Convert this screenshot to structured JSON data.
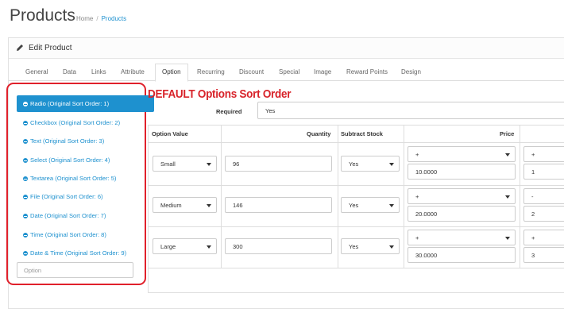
{
  "header": {
    "title": "Products",
    "breadcrumb": [
      "Home",
      "Products"
    ]
  },
  "panel": {
    "title": "Edit Product"
  },
  "tabs": [
    "General",
    "Data",
    "Links",
    "Attribute",
    "Option",
    "Recurring",
    "Discount",
    "Special",
    "Image",
    "Reward Points",
    "Design"
  ],
  "active_tab": "Option",
  "options": [
    "Radio (Original Sort Order: 1)",
    "Checkbox (Original Sort Order: 2)",
    "Text (Original Sort Order: 3)",
    "Select (Original Sort Order: 4)",
    "Textarea (Original Sort Order: 5)",
    "File (Original Sort Order: 6)",
    "Date (Original Sort Order: 7)",
    "Time (Original Sort Order: 8)",
    "Date & Time (Original Sort Order: 9)"
  ],
  "option_input": {
    "placeholder": "Option"
  },
  "annotation": "DEFAULT Options Sort Order",
  "required": {
    "label": "Required",
    "value": "Yes"
  },
  "table": {
    "headers": [
      "Option Value",
      "Quantity",
      "Subtract Stock",
      "Price"
    ],
    "rows": [
      {
        "value": "Small",
        "quantity": "96",
        "subtract": "Yes",
        "price_prefix": "+",
        "price": "10.0000",
        "extra_prefix": "+",
        "extra": "1"
      },
      {
        "value": "Medium",
        "quantity": "146",
        "subtract": "Yes",
        "price_prefix": "+",
        "price": "20.0000",
        "extra_prefix": "-",
        "extra": "2"
      },
      {
        "value": "Large",
        "quantity": "300",
        "subtract": "Yes",
        "price_prefix": "+",
        "price": "30.0000",
        "extra_prefix": "+",
        "extra": "3"
      }
    ]
  },
  "colors": {
    "accent": "#1e91cf",
    "annotation": "#d8232a"
  }
}
